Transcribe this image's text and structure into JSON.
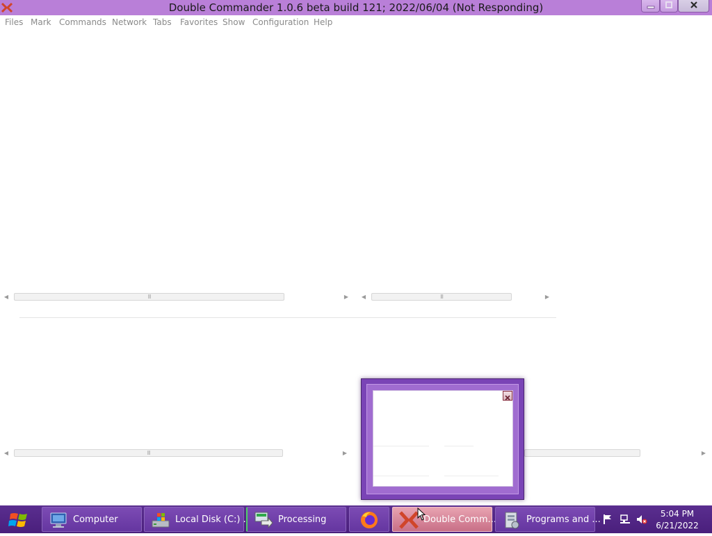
{
  "window": {
    "title": "Double Commander 1.0.6 beta build 121; 2022/06/04 (Not Responding)",
    "accent": "#b97fd8"
  },
  "menu": [
    "Files",
    "Mark",
    "Commands",
    "Network",
    "Tabs",
    "Favorites",
    "Show",
    "Configuration",
    "Help"
  ],
  "scrollbars": {
    "grip_glyph": "III",
    "left_arrow": "◀",
    "right_arrow": "▶"
  },
  "taskbar": {
    "buttons": [
      {
        "label": "Computer",
        "icon": "computer-icon"
      },
      {
        "label": "Local Disk (C:) ...",
        "icon": "local-disk-icon"
      },
      {
        "label": "Processing",
        "icon": "processing-icon"
      },
      {
        "label": "",
        "icon": "firefox-icon"
      },
      {
        "label": "Double Comm...",
        "icon": "double-commander-icon",
        "active": true
      },
      {
        "label": "Programs and ...",
        "icon": "programs-icon"
      }
    ],
    "color": "#5a2e8f"
  },
  "clock": {
    "time": "5:04 PM",
    "date": "6/21/2022"
  }
}
